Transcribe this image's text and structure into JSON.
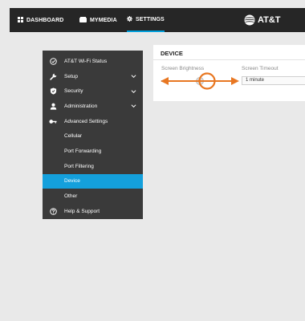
{
  "topnav": {
    "items": [
      {
        "label": "DASHBOARD",
        "icon": "dashboard-icon"
      },
      {
        "label": "MYMEDIA",
        "icon": "media-icon"
      },
      {
        "label": "SETTINGS",
        "icon": "gear-icon"
      }
    ],
    "logo": "AT&T"
  },
  "sidebar": {
    "items": [
      {
        "label": "AT&T Wi-Fi Status",
        "icon": "check-circle-icon"
      },
      {
        "label": "Setup",
        "icon": "wrench-icon"
      },
      {
        "label": "Security",
        "icon": "shield-icon"
      },
      {
        "label": "Administration",
        "icon": "person-icon"
      },
      {
        "label": "Advanced Settings",
        "icon": "key-icon"
      },
      {
        "label": "Cellular"
      },
      {
        "label": "Port Forwarding"
      },
      {
        "label": "Port Filtering"
      },
      {
        "label": "Device"
      },
      {
        "label": "Other"
      },
      {
        "label": "Help & Support",
        "icon": "help-icon"
      }
    ]
  },
  "device": {
    "title": "DEVICE",
    "brightness_label": "Screen Brightness",
    "timeout_label": "Screen Timeout",
    "timeout_value": "1 minute"
  },
  "colors": {
    "accent": "#14a0dc",
    "callout": "#e87722",
    "sidebar_bg": "#3a3a3a",
    "topbar_bg": "#262626"
  }
}
